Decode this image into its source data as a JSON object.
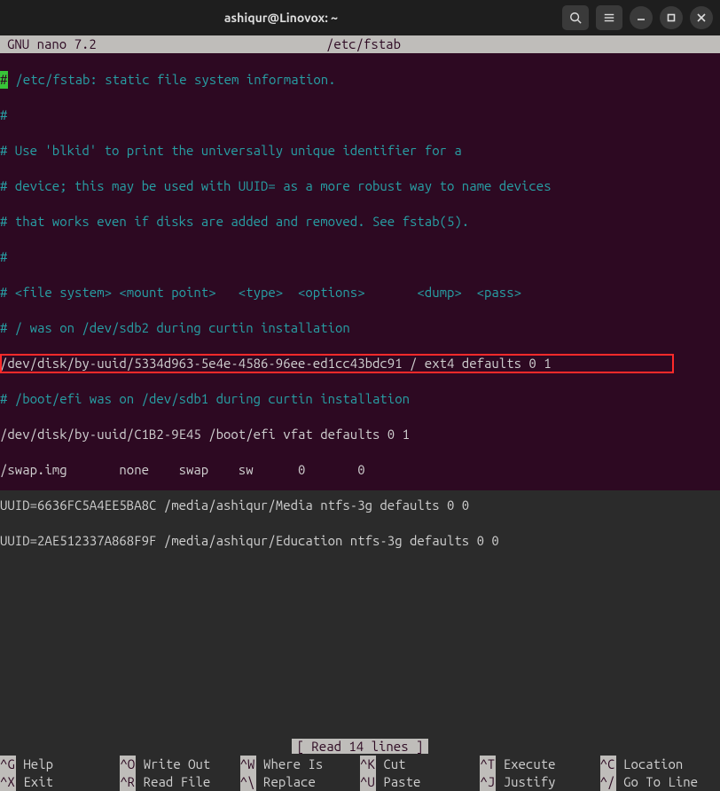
{
  "titlebar": {
    "title": "ashiqur@Linovox: ~"
  },
  "nano": {
    "app_label": " GNU nano 7.2",
    "filename": "/etc/fstab",
    "status": "[ Read 14 lines ]"
  },
  "lines": {
    "l0": "# /etc/fstab: static file system information.",
    "l1": "#",
    "l2": "# Use 'blkid' to print the universally unique identifier for a",
    "l3": "# device; this may be used with UUID= as a more robust way to name devices",
    "l4": "# that works even if disks are added and removed. See fstab(5).",
    "l5": "#",
    "l6": "# <file system> <mount point>   <type>  <options>       <dump>  <pass>",
    "l7": "# / was on /dev/sdb2 during curtin installation",
    "l8": "/dev/disk/by-uuid/5334d963-5e4e-4586-96ee-ed1cc43bdc91 / ext4 defaults 0 1",
    "l9": "# /boot/efi was on /dev/sdb1 during curtin installation",
    "l10": "/dev/disk/by-uuid/C1B2-9E45 /boot/efi vfat defaults 0 1",
    "l11": "/swap.img       none    swap    sw      0       0",
    "l12": "UUID=6636FC5A4EE5BA8C /media/ashiqur/Media ntfs-3g defaults 0 0",
    "l13": "UUID=2AE512337A868F9F /media/ashiqur/Education ntfs-3g defaults 0 0"
  },
  "shortcuts": {
    "r0": [
      {
        "key": "^G",
        "label": " Help"
      },
      {
        "key": "^O",
        "label": " Write Out"
      },
      {
        "key": "^W",
        "label": " Where Is"
      },
      {
        "key": "^K",
        "label": " Cut"
      },
      {
        "key": "^T",
        "label": " Execute"
      },
      {
        "key": "^C",
        "label": " Location"
      }
    ],
    "r1": [
      {
        "key": "^X",
        "label": " Exit"
      },
      {
        "key": "^R",
        "label": " Read File"
      },
      {
        "key": "^\\",
        "label": " Replace"
      },
      {
        "key": "^U",
        "label": " Paste"
      },
      {
        "key": "^J",
        "label": " Justify"
      },
      {
        "key": "^/",
        "label": " Go To Line"
      }
    ]
  }
}
